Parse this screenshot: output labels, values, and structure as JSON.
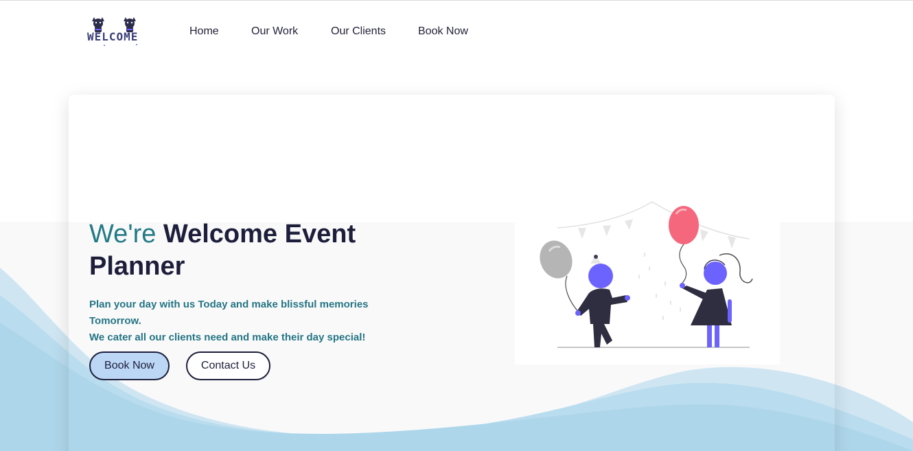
{
  "nav": {
    "logo_text": "WELCOME",
    "links": [
      "Home",
      "Our Work",
      "Our Clients",
      "Book Now"
    ]
  },
  "hero": {
    "title_accent": "We're",
    "title_rest": "Welcome Event Planner",
    "subtitle_line1": "Plan your day with us Today and make blissful memories Tomorrow.",
    "subtitle_line2": "We cater all our clients need and make their day special!",
    "primary_button": "Book Now",
    "secondary_button": "Contact Us"
  },
  "colors": {
    "accent": "#237a85",
    "heading": "#1c1e3a",
    "primary_button_bg": "#bcd7f5",
    "illustration_purple": "#6c63ff",
    "balloon_pink": "#f5677d",
    "wave_blue": "#aed6ea"
  },
  "icons": {
    "logo": "welcome-cats-logo",
    "illustration": "kids-with-balloons-illustration"
  }
}
